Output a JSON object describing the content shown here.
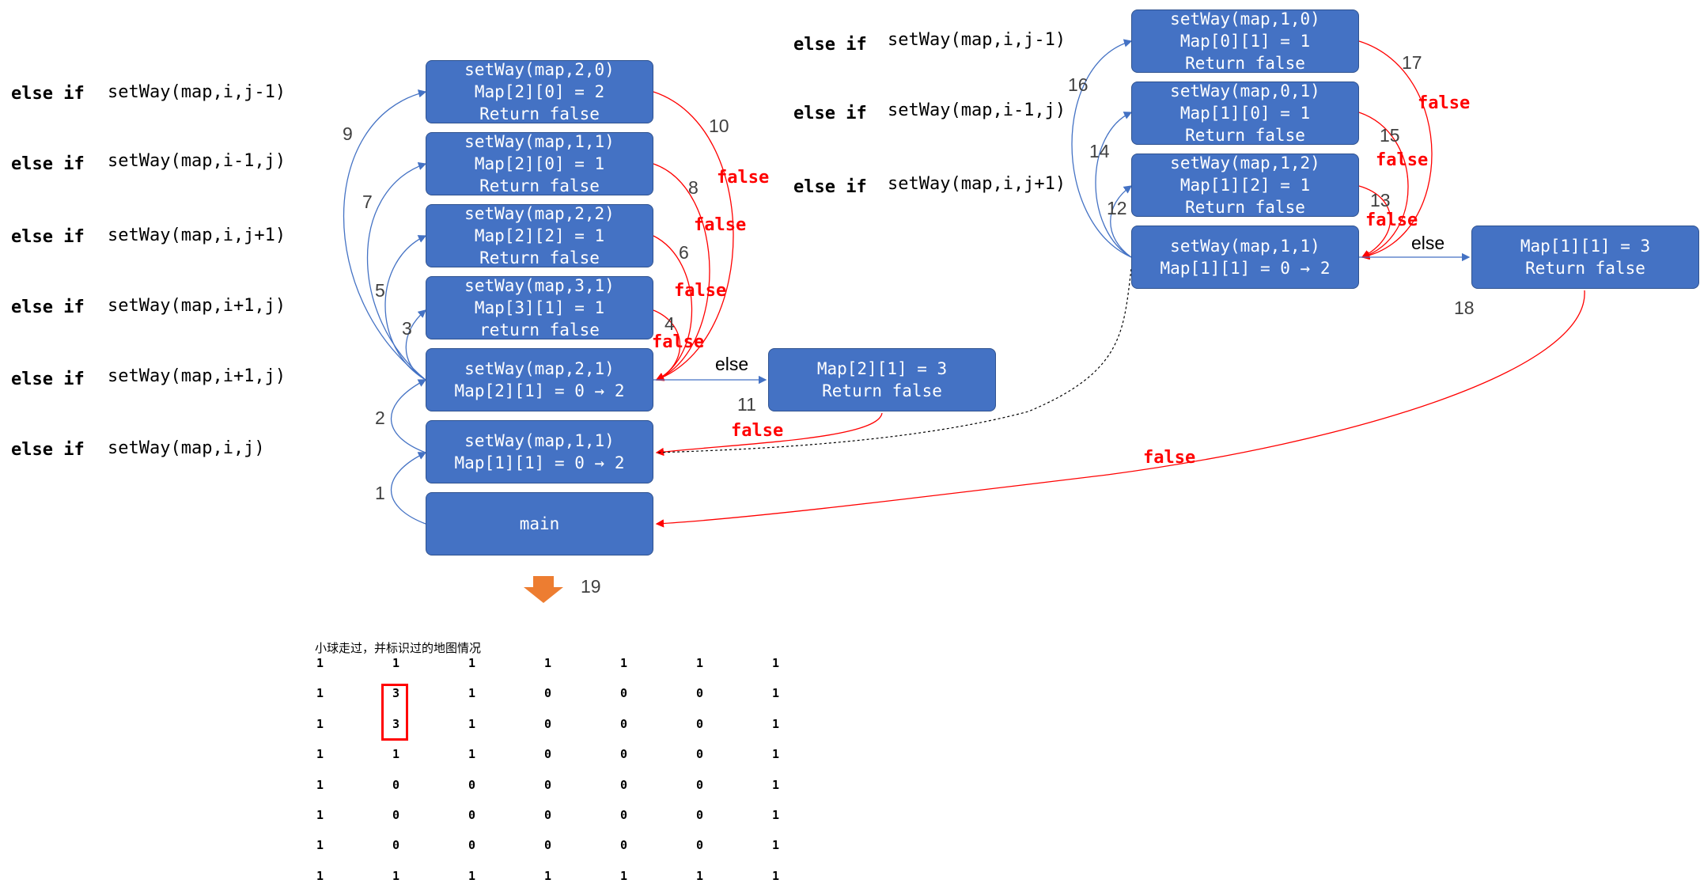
{
  "left_conditions": [
    {
      "keyword": "else if",
      "call": "setWay(map,i,j-1)"
    },
    {
      "keyword": "else if",
      "call": "setWay(map,i-1,j)"
    },
    {
      "keyword": "else if",
      "call": "setWay(map,i,j+1)"
    },
    {
      "keyword": "else if",
      "call": "setWay(map,i+1,j)"
    },
    {
      "keyword": "else if",
      "call": "setWay(map,i+1,j)"
    },
    {
      "keyword": "else if",
      "call": "setWay(map,i,j)"
    }
  ],
  "right_conditions": [
    {
      "keyword": "else if",
      "call": "setWay(map,i,j-1)"
    },
    {
      "keyword": "else if",
      "call": "setWay(map,i-1,j)"
    },
    {
      "keyword": "else if",
      "call": "setWay(map,i,j+1)"
    }
  ],
  "left_stack": [
    {
      "lines": [
        "setWay(map,2,0)",
        "Map[2][0] = 2",
        "Return false"
      ]
    },
    {
      "lines": [
        "setWay(map,1,1)",
        "Map[2][0] = 1",
        "Return false"
      ]
    },
    {
      "lines": [
        "setWay(map,2,2)",
        "Map[2][2] = 1",
        "Return false"
      ]
    },
    {
      "lines": [
        "setWay(map,3,1)",
        "Map[3][1] = 1",
        "return false"
      ]
    },
    {
      "lines": [
        "setWay(map,2,1)",
        "Map[2][1] = 0 → 2"
      ]
    },
    {
      "lines": [
        "setWay(map,1,1)",
        "Map[1][1] = 0 → 2"
      ]
    },
    {
      "lines": [
        "main"
      ]
    }
  ],
  "left_else_box": {
    "lines": [
      "Map[2][1] = 3",
      "Return false"
    ]
  },
  "right_stack": [
    {
      "lines": [
        "setWay(map,1,0)",
        "Map[0][1] = 1",
        "Return false"
      ]
    },
    {
      "lines": [
        "setWay(map,0,1)",
        "Map[1][0] = 1",
        "Return false"
      ]
    },
    {
      "lines": [
        "setWay(map,1,2)",
        "Map[1][2] = 1",
        "Return false"
      ]
    },
    {
      "lines": [
        "setWay(map,1,1)",
        "Map[1][1] = 0 → 2"
      ]
    }
  ],
  "right_else_box": {
    "lines": [
      "Map[1][1] = 3",
      "Return false"
    ]
  },
  "step_numbers": [
    "1",
    "2",
    "3",
    "4",
    "5",
    "6",
    "7",
    "8",
    "9",
    "10",
    "11",
    "12",
    "13",
    "14",
    "15",
    "16",
    "17",
    "18",
    "19"
  ],
  "false_label": "false",
  "else_label": "else",
  "grid": {
    "caption": "小球走过，并标识过的地图情况",
    "rows": [
      [
        "1",
        "1",
        "1",
        "1",
        "1",
        "1",
        "1"
      ],
      [
        "1",
        "3",
        "1",
        "0",
        "0",
        "0",
        "1"
      ],
      [
        "1",
        "3",
        "1",
        "0",
        "0",
        "0",
        "1"
      ],
      [
        "1",
        "1",
        "1",
        "0",
        "0",
        "0",
        "1"
      ],
      [
        "1",
        "0",
        "0",
        "0",
        "0",
        "0",
        "1"
      ],
      [
        "1",
        "0",
        "0",
        "0",
        "0",
        "0",
        "1"
      ],
      [
        "1",
        "0",
        "0",
        "0",
        "0",
        "0",
        "1"
      ],
      [
        "1",
        "1",
        "1",
        "1",
        "1",
        "1",
        "1"
      ]
    ]
  },
  "colors": {
    "box": "#4472c4",
    "call_arrow": "#4472c4",
    "return_arrow": "#ff0000",
    "down_arrow": "#ed7d31",
    "false_text": "#ff0000"
  }
}
